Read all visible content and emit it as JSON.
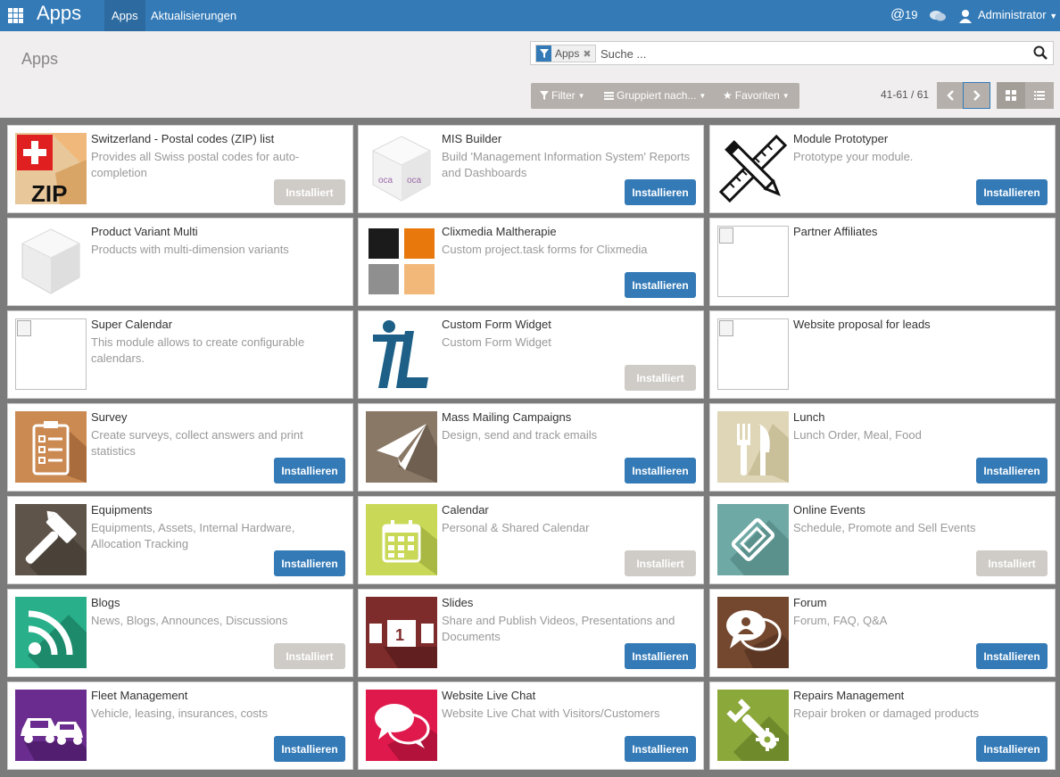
{
  "navbar": {
    "brand": "Apps",
    "menu": [
      "Apps",
      "Aktualisierungen"
    ],
    "mentions_count": "19",
    "user_name": "Administrator"
  },
  "control_panel": {
    "title": "Apps",
    "search_facet": "Apps",
    "search_placeholder": "Suche ...",
    "filter_label": "Filter",
    "group_label": "Gruppiert nach...",
    "favorites_label": "Favoriten",
    "pager": "41-61 / 61"
  },
  "labels": {
    "install": "Installieren",
    "installed": "Installiert"
  },
  "apps": [
    {
      "title": "Switzerland - Postal codes (ZIP) list",
      "desc": "Provides all Swiss postal codes for auto-completion",
      "button": "Installiert",
      "icon": "swiss-zip-icon"
    },
    {
      "title": "MIS Builder",
      "desc": "Build 'Management Information System' Reports and Dashboards",
      "button": "Installieren",
      "icon": "mis-builder-cube-icon"
    },
    {
      "title": "Module Prototyper",
      "desc": "Prototype your module.",
      "button": "Installieren",
      "icon": "pencil-ruler-icon"
    },
    {
      "title": "Product Variant Multi",
      "desc": "Products with multi-dimension variants",
      "button": "",
      "icon": "module-cube-icon"
    },
    {
      "title": "Clixmedia Maltherapie",
      "desc": "Custom project.task forms for Clixmedia",
      "button": "Installieren",
      "icon": "color-squares-icon"
    },
    {
      "title": "Partner Affiliates",
      "desc": "",
      "button": "",
      "icon": "broken-image-icon"
    },
    {
      "title": "Super Calendar",
      "desc": "This module allows to create configurable calendars.",
      "button": "",
      "icon": "broken-image-icon"
    },
    {
      "title": "Custom Form Widget",
      "desc": "Custom Form Widget",
      "button": "Installiert",
      "icon": "itl-logo-icon"
    },
    {
      "title": "Website proposal for leads",
      "desc": "",
      "button": "",
      "icon": "broken-image-icon"
    },
    {
      "title": "Survey",
      "desc": "Create surveys, collect answers and print statistics",
      "button": "Installieren",
      "icon": "clipboard-icon"
    },
    {
      "title": "Mass Mailing Campaigns",
      "desc": "Design, send and track emails",
      "button": "Installieren",
      "icon": "paper-plane-icon"
    },
    {
      "title": "Lunch",
      "desc": "Lunch Order, Meal, Food",
      "button": "Installieren",
      "icon": "fork-knife-icon"
    },
    {
      "title": "Equipments",
      "desc": "Equipments, Assets, Internal Hardware, Allocation Tracking",
      "button": "Installieren",
      "icon": "hammer-icon"
    },
    {
      "title": "Calendar",
      "desc": "Personal & Shared Calendar",
      "button": "Installiert",
      "icon": "calendar-icon"
    },
    {
      "title": "Online Events",
      "desc": "Schedule, Promote and Sell Events",
      "button": "Installiert",
      "icon": "ticket-icon"
    },
    {
      "title": "Blogs",
      "desc": "News, Blogs, Announces, Discussions",
      "button": "Installiert",
      "icon": "rss-icon"
    },
    {
      "title": "Slides",
      "desc": "Share and Publish Videos, Presentations and Documents",
      "button": "Installieren",
      "icon": "slides-icon"
    },
    {
      "title": "Forum",
      "desc": "Forum, FAQ, Q&A",
      "button": "Installieren",
      "icon": "forum-bubbles-icon"
    },
    {
      "title": "Fleet Management",
      "desc": "Vehicle, leasing, insurances, costs",
      "button": "Installieren",
      "icon": "cars-icon"
    },
    {
      "title": "Website Live Chat",
      "desc": "Website Live Chat with Visitors/Customers",
      "button": "Installieren",
      "icon": "chat-bubbles-icon"
    },
    {
      "title": "Repairs Management",
      "desc": "Repair broken or damaged products",
      "button": "Installieren",
      "icon": "wrench-gear-icon"
    }
  ]
}
